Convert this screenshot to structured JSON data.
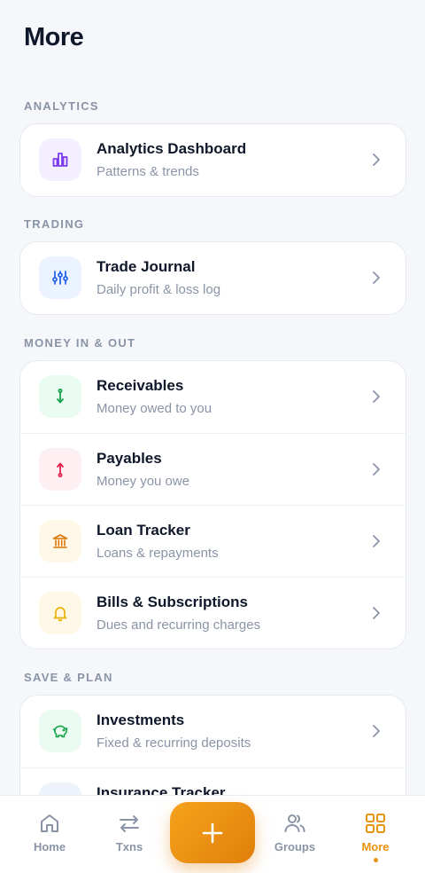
{
  "page": {
    "title": "More"
  },
  "sections": [
    {
      "label": "ANALYTICS",
      "items": [
        {
          "title": "Analytics Dashboard",
          "subtitle": "Patterns & trends",
          "icon": "bar-chart-icon",
          "tint": "#f3efff",
          "color": "#7c3aed"
        }
      ]
    },
    {
      "label": "TRADING",
      "items": [
        {
          "title": "Trade Journal",
          "subtitle": "Daily profit & loss log",
          "icon": "sliders-icon",
          "tint": "#eaf3ff",
          "color": "#2563eb"
        }
      ]
    },
    {
      "label": "MONEY IN & OUT",
      "items": [
        {
          "title": "Receivables",
          "subtitle": "Money owed to you",
          "icon": "arrow-in-icon",
          "tint": "#eafbf1",
          "color": "#16a34a"
        },
        {
          "title": "Payables",
          "subtitle": "Money you owe",
          "icon": "arrow-out-icon",
          "tint": "#fdeff2",
          "color": "#e11d48"
        },
        {
          "title": "Loan Tracker",
          "subtitle": "Loans & repayments",
          "icon": "bank-icon",
          "tint": "#fff8e8",
          "color": "#d97706"
        },
        {
          "title": "Bills & Subscriptions",
          "subtitle": "Dues and recurring charges",
          "icon": "bell-icon",
          "tint": "#fff8e6",
          "color": "#eab308"
        }
      ]
    },
    {
      "label": "SAVE & PLAN",
      "items": [
        {
          "title": "Investments",
          "subtitle": "Fixed & recurring deposits",
          "icon": "piggy-bank-icon",
          "tint": "#eafbf1",
          "color": "#16a34a"
        },
        {
          "title": "Insurance Tracker",
          "subtitle": "",
          "icon": "shield-icon",
          "tint": "#eef2fb",
          "color": "#4f6ad8"
        }
      ]
    }
  ],
  "nav": {
    "home": "Home",
    "txns": "Txns",
    "groups": "Groups",
    "more": "More",
    "active": "more",
    "accent": "#e8920c"
  }
}
